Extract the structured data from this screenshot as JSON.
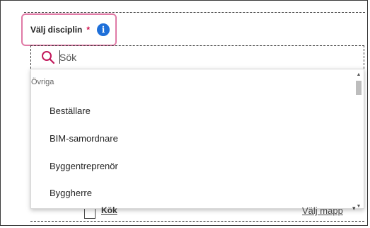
{
  "field": {
    "label": "Välj disciplin",
    "required_marker": "*",
    "info_icon": "info-icon",
    "info_glyph": "i"
  },
  "search": {
    "placeholder": "Sök",
    "icon": "search-icon",
    "value": ""
  },
  "dropdown": {
    "group_label": "Övriga",
    "options": [
      {
        "label": "Beställare"
      },
      {
        "label": "BIM-samordnare"
      },
      {
        "label": "Byggentreprenör"
      },
      {
        "label": "Byggherre"
      }
    ]
  },
  "behind": {
    "row_label": "Kök",
    "action_label": "Välj mapp",
    "arrow": "▾"
  },
  "colors": {
    "highlight": "#e07aa6",
    "required": "#d0104c",
    "info": "#1e6fd9",
    "search_icon": "#c2185b"
  }
}
